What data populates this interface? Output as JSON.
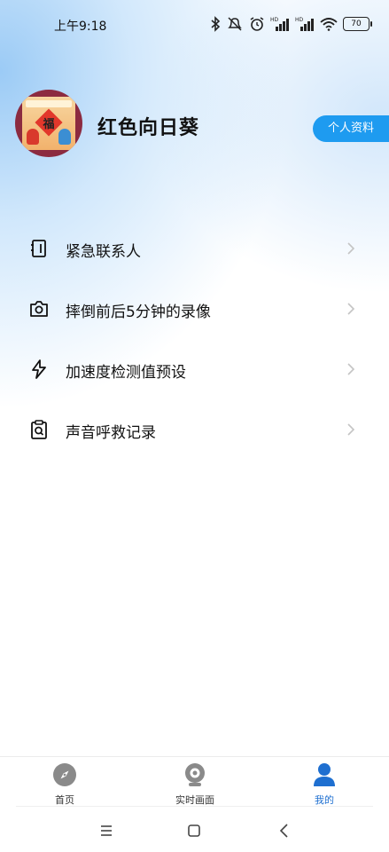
{
  "status_bar": {
    "time": "上午9:18",
    "battery": "70",
    "icons": [
      "bluetooth-icon",
      "mute-icon",
      "alarm-icon",
      "hd-signal-icon",
      "hd-signal-icon",
      "wifi-icon",
      "battery-icon"
    ]
  },
  "profile": {
    "avatar_text": "福",
    "username": "红色向日葵",
    "profile_button": "个人资料"
  },
  "menu": {
    "items": [
      {
        "label": "紧急联系人",
        "icon": "contacts-book-icon"
      },
      {
        "label": "摔倒前后5分钟的录像",
        "icon": "camera-icon"
      },
      {
        "label": "加速度检测值预设",
        "icon": "lightning-icon"
      },
      {
        "label": "声音呼救记录",
        "icon": "clipboard-search-icon"
      }
    ]
  },
  "tabs": {
    "home": "首页",
    "live": "实时画面",
    "mine": "我的",
    "active": "mine"
  },
  "colors": {
    "accent": "#1e9bf0",
    "tab_active": "#1e6fd0",
    "tab_inactive_icon": "#8a8a8a"
  }
}
